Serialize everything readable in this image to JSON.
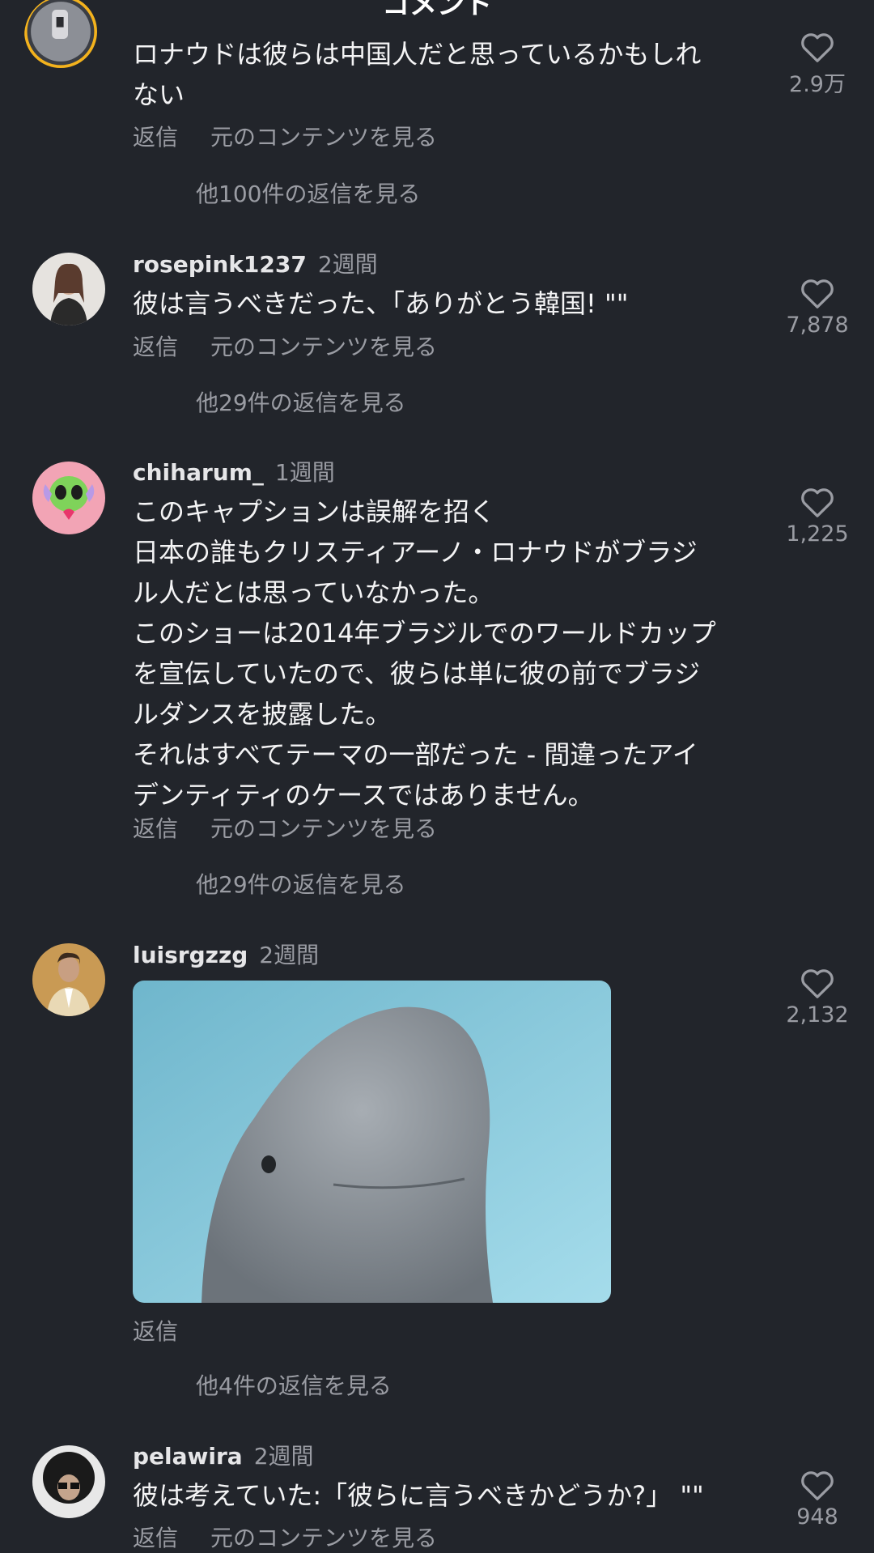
{
  "header": {
    "title": "コメント"
  },
  "comments": [
    {
      "username": "",
      "time": "",
      "lines": [
        "ロナウドは彼らは中国人だと思っているかもしれ",
        "ない"
      ],
      "reply_label": "返信",
      "view_original_label": "元のコンテンツを見る",
      "more_replies": "他100件の返信を見る",
      "likes": "2.9万"
    },
    {
      "username": "rosepink1237",
      "time": "2週間",
      "lines": [
        "彼は言うべきだった、「ありがとう韓国! \"\""
      ],
      "reply_label": "返信",
      "view_original_label": "元のコンテンツを見る",
      "more_replies": "他29件の返信を見る",
      "likes": "7,878"
    },
    {
      "username": "chiharum_",
      "time": "1週間",
      "lines": [
        "このキャプションは誤解を招く",
        "日本の誰もクリスティアーノ・ロナウドがブラジ",
        "ル人だとは思っていなかった。",
        "このショーは2014年ブラジルでのワールドカップ",
        "を宣伝していたので、彼らは単に彼の前でブラジ",
        "ルダンスを披露した。",
        "それはすべてテーマの一部だった - 間違ったアイ",
        "デンティティのケースではありません。"
      ],
      "reply_label": "返信",
      "view_original_label": "元のコンテンツを見る",
      "more_replies": "他29件の返信を見る",
      "likes": "1,225"
    },
    {
      "username": "luisrgzzg",
      "time": "2週間",
      "reply_label": "返信",
      "more_replies": "他4件の返信を見る",
      "likes": "2,132"
    },
    {
      "username": "pelawira",
      "time": "2週間",
      "lines": [
        "彼は考えていた:「彼らに言うべきかどうか?」 \"\""
      ],
      "reply_label": "返信",
      "view_original_label": "元のコンテンツを見る",
      "likes": "948"
    }
  ],
  "colors": {
    "background": "#22252b",
    "muted_text": "#9a9ca3",
    "gif_background": "#7fc6dc"
  }
}
